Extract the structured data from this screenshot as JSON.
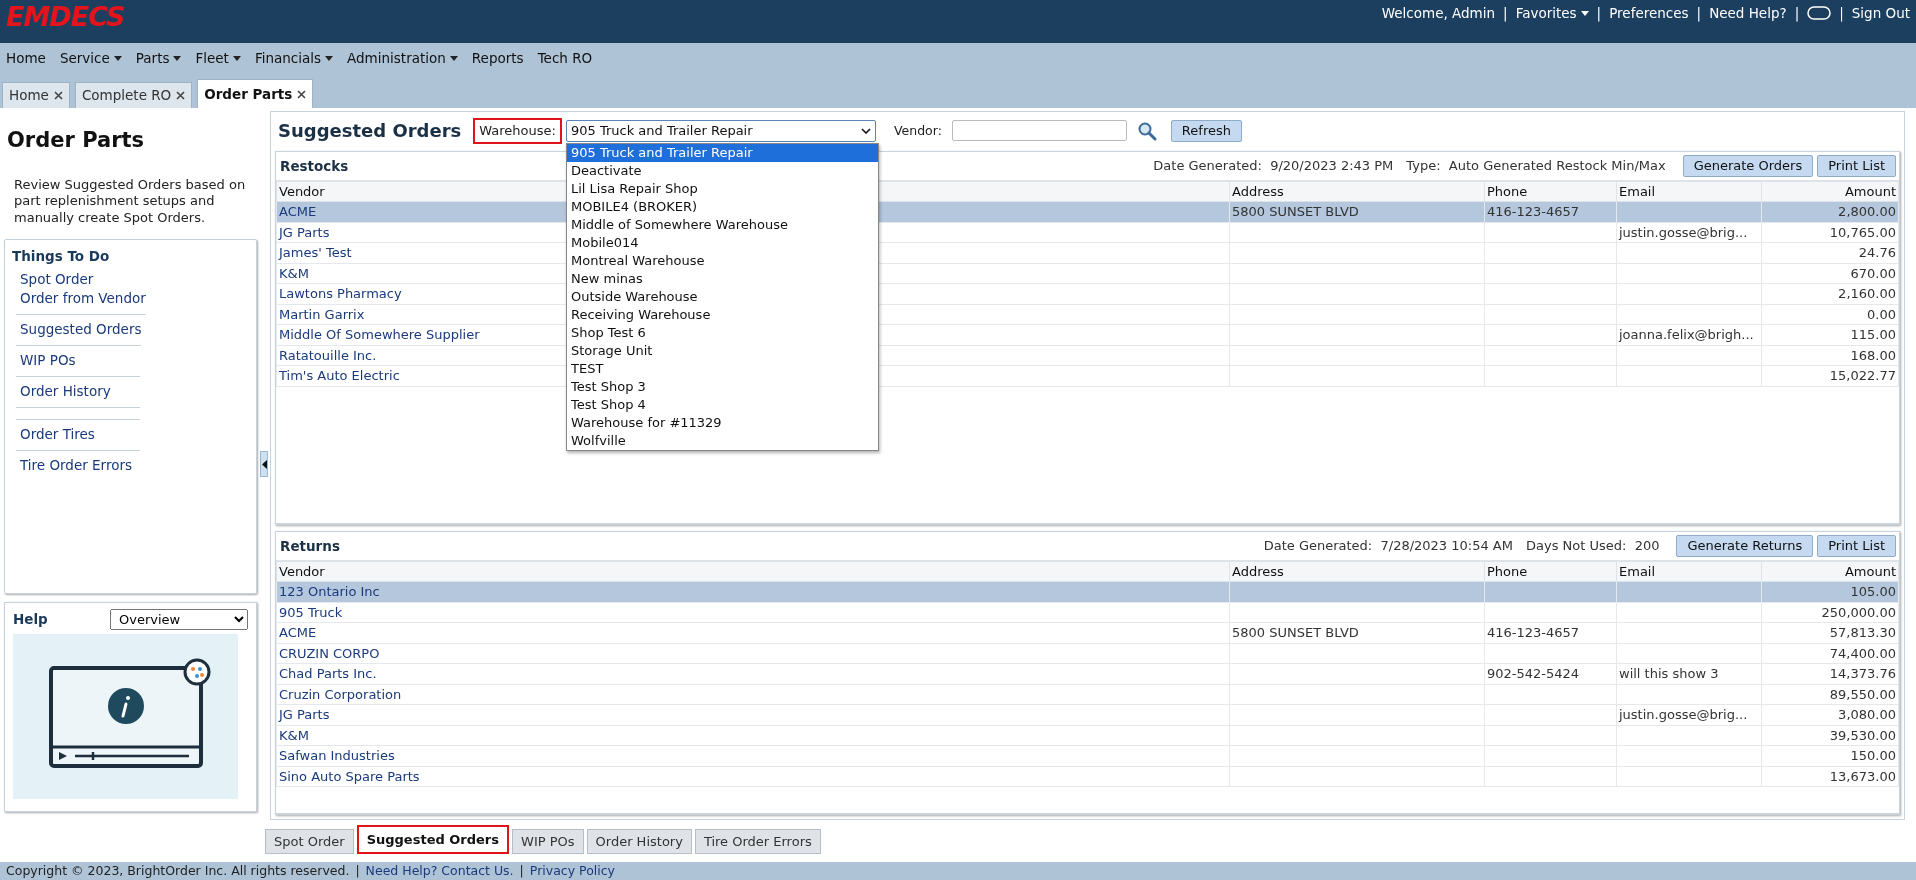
{
  "header": {
    "logo": "EMDECS",
    "items": [
      {
        "kind": "text",
        "label": "Welcome, Admin"
      },
      {
        "kind": "dropdown",
        "label": "Favorites"
      },
      {
        "kind": "link",
        "label": "Preferences"
      },
      {
        "kind": "link",
        "label": "Need Help?"
      },
      {
        "kind": "icon"
      },
      {
        "kind": "link",
        "label": "Sign Out"
      }
    ],
    "separator": "|"
  },
  "menu": [
    {
      "label": "Home",
      "has_caret": false
    },
    {
      "label": "Service",
      "has_caret": true
    },
    {
      "label": "Parts",
      "has_caret": true
    },
    {
      "label": "Fleet",
      "has_caret": true
    },
    {
      "label": "Financials",
      "has_caret": true
    },
    {
      "label": "Administration",
      "has_caret": true
    },
    {
      "label": "Reports",
      "has_caret": false
    },
    {
      "label": "Tech RO",
      "has_caret": false
    }
  ],
  "tabs": [
    {
      "label": "Home",
      "closable": true,
      "selected": false
    },
    {
      "label": "Complete RO",
      "closable": true,
      "selected": false
    },
    {
      "label": "Order Parts",
      "closable": true,
      "selected": true
    }
  ],
  "sidebar": {
    "title": "Order Parts",
    "description": "Review Suggested Orders based on part replenishment setups and manually create Spot Orders.",
    "things_to_do": {
      "title": "Things To Do",
      "items": [
        {
          "kind": "link",
          "label": "Spot Order",
          "divider": false
        },
        {
          "kind": "link",
          "label": "Order from Vendor",
          "divider": true
        },
        {
          "kind": "link",
          "label": "Suggested Orders",
          "divider": true
        },
        {
          "kind": "link",
          "label": "WIP POs",
          "divider": true
        },
        {
          "kind": "link",
          "label": "Order History",
          "divider": true
        },
        {
          "kind": "spacer",
          "divider": true
        },
        {
          "kind": "link",
          "label": "Order Tires",
          "divider": true
        },
        {
          "kind": "link",
          "label": "Tire Order Errors",
          "divider": false
        }
      ]
    },
    "help": {
      "title": "Help",
      "topic": "Overview"
    }
  },
  "main": {
    "title": "Suggested Orders",
    "warehouse": {
      "label": "Warehouse:",
      "highlighted": true,
      "value": "905 Truck and Trailer Repair",
      "expanded": true,
      "options": [
        {
          "label": "905 Truck and Trailer Repair",
          "selected": true
        },
        {
          "label": "Deactivate",
          "selected": false
        },
        {
          "label": "Lil Lisa Repair Shop",
          "selected": false
        },
        {
          "label": "MOBILE4 (BROKER)",
          "selected": false
        },
        {
          "label": "Middle of Somewhere Warehouse",
          "selected": false
        },
        {
          "label": "Mobile014",
          "selected": false
        },
        {
          "label": "Montreal Warehouse",
          "selected": false
        },
        {
          "label": "New minas",
          "selected": false
        },
        {
          "label": "Outside Warehouse",
          "selected": false
        },
        {
          "label": "Receiving Warehouse",
          "selected": false
        },
        {
          "label": "Shop Test 6",
          "selected": false
        },
        {
          "label": "Storage Unit",
          "selected": false
        },
        {
          "label": "TEST",
          "selected": false
        },
        {
          "label": "Test Shop 3",
          "selected": false
        },
        {
          "label": "Test Shop 4",
          "selected": false
        },
        {
          "label": "Warehouse for #11329",
          "selected": false
        },
        {
          "label": "Wolfville",
          "selected": false
        }
      ]
    },
    "vendor": {
      "label": "Vendor:"
    },
    "refresh": "Refresh",
    "sections": [
      {
        "title": "Restocks",
        "meta": [
          {
            "label": "Date Generated:",
            "value": "9/20/2023 2:43 PM"
          },
          {
            "label": "Type:",
            "value": "Auto Generated Restock Min/Max"
          }
        ],
        "buttons": [
          "Generate Orders",
          "Print List"
        ],
        "columns": [
          "Vendor",
          "Address",
          "Phone",
          "Email",
          "Amount"
        ],
        "rows": [
          {
            "cells": [
              "ACME",
              "5800 SUNSET BLVD",
              "416-123-4657",
              "",
              "2,800.00"
            ],
            "selected": true
          },
          {
            "cells": [
              "JG Parts",
              "",
              "",
              "justin.gosse@brig...",
              "10,765.00"
            ],
            "selected": false
          },
          {
            "cells": [
              "James' Test",
              "",
              "",
              "",
              "24.76"
            ],
            "selected": false
          },
          {
            "cells": [
              "K&M",
              "",
              "",
              "",
              "670.00"
            ],
            "selected": false
          },
          {
            "cells": [
              "Lawtons Pharmacy",
              "",
              "",
              "",
              "2,160.00"
            ],
            "selected": false
          },
          {
            "cells": [
              "Martin Garrix",
              "",
              "",
              "",
              "0.00"
            ],
            "selected": false
          },
          {
            "cells": [
              "Middle Of Somewhere Supplier",
              "",
              "",
              "joanna.felix@brigh...",
              "115.00"
            ],
            "selected": false
          },
          {
            "cells": [
              "Ratatouille Inc.",
              "",
              "",
              "",
              "168.00"
            ],
            "selected": false
          },
          {
            "cells": [
              "Tim's Auto Electric",
              "",
              "",
              "",
              "15,022.77"
            ],
            "selected": false
          }
        ]
      },
      {
        "title": "Returns",
        "meta": [
          {
            "label": "Date Generated:",
            "value": "7/28/2023 10:54 AM"
          },
          {
            "label": "Days Not Used:",
            "value": "200"
          }
        ],
        "buttons": [
          "Generate Returns",
          "Print List"
        ],
        "columns": [
          "Vendor",
          "Address",
          "Phone",
          "Email",
          "Amount"
        ],
        "rows": [
          {
            "cells": [
              "123 Ontario Inc",
              "",
              "",
              "",
              "105.00"
            ],
            "selected": true
          },
          {
            "cells": [
              "905 Truck",
              "",
              "",
              "",
              "250,000.00"
            ],
            "selected": false
          },
          {
            "cells": [
              "ACME",
              "5800 SUNSET BLVD",
              "416-123-4657",
              "",
              "57,813.30"
            ],
            "selected": false
          },
          {
            "cells": [
              "CRUZIN CORPO",
              "",
              "",
              "",
              "74,400.00"
            ],
            "selected": false
          },
          {
            "cells": [
              "Chad Parts Inc.",
              "",
              "902-542-5424",
              "will this show 3",
              "14,373.76"
            ],
            "selected": false
          },
          {
            "cells": [
              "Cruzin Corporation",
              "",
              "",
              "",
              "89,550.00"
            ],
            "selected": false
          },
          {
            "cells": [
              "JG Parts",
              "",
              "",
              "justin.gosse@brig...",
              "3,080.00"
            ],
            "selected": false
          },
          {
            "cells": [
              "K&M",
              "",
              "",
              "",
              "39,530.00"
            ],
            "selected": false
          },
          {
            "cells": [
              "Safwan Industries",
              "",
              "",
              "",
              "150.00"
            ],
            "selected": false
          },
          {
            "cells": [
              "Sino Auto Spare Parts",
              "",
              "",
              "",
              "13,673.00"
            ],
            "selected": false
          }
        ]
      }
    ]
  },
  "bottom_tabs": [
    {
      "label": "Spot Order",
      "selected": false,
      "highlighted": false
    },
    {
      "label": "Suggested Orders",
      "selected": true,
      "highlighted": true
    },
    {
      "label": "WIP POs",
      "selected": false,
      "highlighted": false
    },
    {
      "label": "Order History",
      "selected": false,
      "highlighted": false
    },
    {
      "label": "Tire Order Errors",
      "selected": false,
      "highlighted": false
    }
  ],
  "footer": {
    "copyright": "Copyright © 2023, BrightOrder Inc. All rights reserved.",
    "separator": "|",
    "links": [
      "Need Help? Contact Us.",
      "Privacy Policy"
    ]
  }
}
